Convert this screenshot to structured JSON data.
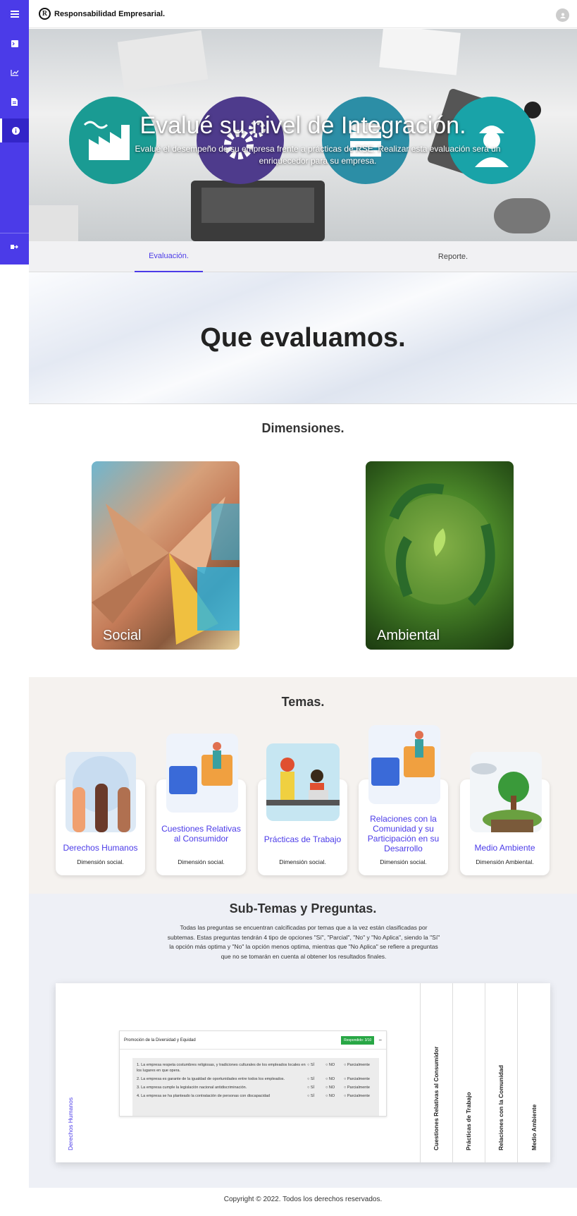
{
  "sidebar": {
    "items": [
      {
        "icon": "menu-icon"
      },
      {
        "icon": "terminal-icon"
      },
      {
        "icon": "chart-line-icon"
      },
      {
        "icon": "document-icon"
      },
      {
        "icon": "info-icon",
        "active": true
      },
      {
        "icon": "logout-icon"
      }
    ]
  },
  "topbar": {
    "brand": "Responsabilidad Empresarial.",
    "logo_letter": "R"
  },
  "hero": {
    "title": "Evalué su nivel de Integración.",
    "subtitle": "Evalué el desempeño de su empresa frente a prácticas de RSE. Realizar esta evaluación será un enriquecedor para su empresa."
  },
  "tabs": [
    {
      "label": "Evaluación.",
      "active": true
    },
    {
      "label": "Reporte.",
      "active": false
    }
  ],
  "banner": {
    "title": "Que evaluamos."
  },
  "dimensiones": {
    "title": "Dimensiones.",
    "cards": [
      {
        "label": "Social"
      },
      {
        "label": "Ambiental"
      }
    ]
  },
  "temas": {
    "title": "Temas.",
    "cards": [
      {
        "name": "Derechos Humanos",
        "dimension": "Dimensión social."
      },
      {
        "name": "Cuestiones Relativas al Consumidor",
        "dimension": "Dimensión social."
      },
      {
        "name": "Prácticas de Trabajo",
        "dimension": "Dimensión social."
      },
      {
        "name": "Relaciones con la Comunidad y su Participación en su Desarrollo",
        "dimension": "Dimensión social."
      },
      {
        "name": "Medio Ambiente",
        "dimension": "Dimensión Ambiental."
      }
    ]
  },
  "subtemas": {
    "title": "Sub-Temas y Preguntas.",
    "description": "Todas las preguntas se encuentran calcificadas por temas que a la vez están clasificadas por subtemas. Estas preguntas tendrán 4 tipo de opciones \"Sí\", \"Parcial\", \"No\" y \"No Aplica\", siendo la \"Sí\" la opción más optima y \"No\" la opción menos optima, mientras que \"No Aplica\" se refiere a preguntas que no se tomarán en cuenta al obtener los resultados finales.",
    "active_tab": "Derechos Humanos",
    "side_tabs": [
      "Cuestiones Relativas al Consumidor",
      "Prácticas de Trabajo",
      "Relaciones con la Comunidad",
      "Medio Ambiente"
    ],
    "preview": {
      "header": "Promoción de la Diversidad y Equidad",
      "badge": "Respondido: 3/10",
      "options": [
        "SÍ",
        "NO",
        "Parcialmente"
      ],
      "questions": [
        "1. La empresa respeta costumbres religiosas, y tradiciones culturales de los empleados locales en los lugares en que opera.",
        "2. La empresa es garante de la igualdad de oportunidades entre todos los empleados.",
        "3. La empresa cumple la legislación nacional antidiscriminación.",
        "4. La empresa se ha planteado la contratación de personas con discapacidad"
      ]
    }
  },
  "footer": {
    "text": "Copyright © 2022. Todos los derechos reservados."
  },
  "colors": {
    "accent": "#4b3be8",
    "badge_green": "#28a745"
  }
}
